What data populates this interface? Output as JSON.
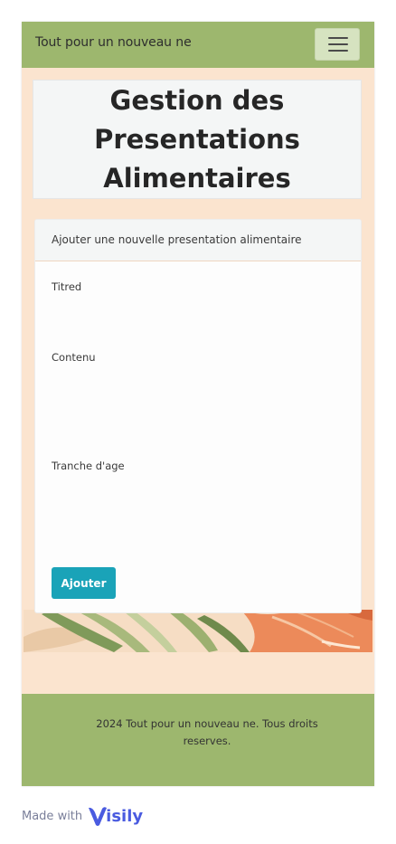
{
  "navbar": {
    "brand": "Tout pour un nouveau ne",
    "toggle_icon": "hamburger-menu-icon"
  },
  "page": {
    "title": "Gestion des Presentations Alimentaires"
  },
  "form": {
    "header": "Ajouter une nouvelle presentation alimentaire",
    "fields": [
      {
        "label": "Titred"
      },
      {
        "label": "Contenu"
      },
      {
        "label": "Tranche d'age"
      }
    ],
    "submit_label": "Ajouter"
  },
  "footer": {
    "text": "2024 Tout pour un nouveau ne. Tous droits reserves."
  },
  "badge": {
    "made_with": "Made with",
    "brand": "isily"
  },
  "colors": {
    "navbar": "#9db76e",
    "background": "#fbe4cf",
    "button": "#1aa3b8",
    "visily_blue": "#4a5be0"
  }
}
